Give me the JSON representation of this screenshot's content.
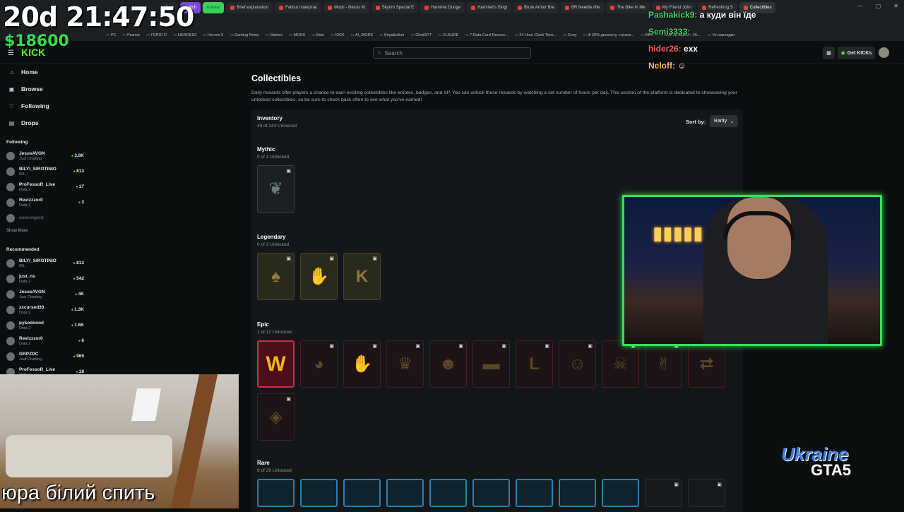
{
  "overlay": {
    "timer": "20d 21:47:50",
    "money": "$18600",
    "room_caption": "юра білий  спить",
    "logo_line1": "Ukraine",
    "logo_line2": "GTA5"
  },
  "browser": {
    "tabs": [
      {
        "label": "Bots",
        "kind": "chip"
      },
      {
        "label": "Twitch",
        "kind": "chip-tw"
      },
      {
        "label": "Kлючи",
        "kind": "chip-k"
      },
      {
        "label": "Brief explanation",
        "kind": "tab"
      },
      {
        "label": "Fallout повертає",
        "kind": "tab"
      },
      {
        "label": "Mods - Nexus M",
        "kind": "tab"
      },
      {
        "label": "Skyrim Special E",
        "kind": "tab"
      },
      {
        "label": "Hammet Dunge",
        "kind": "tab"
      },
      {
        "label": "Hammet's Singl",
        "kind": "tab"
      },
      {
        "label": "Brute Armor Bre",
        "kind": "tab"
      },
      {
        "label": "BR Needle rifle",
        "kind": "tab"
      },
      {
        "label": "The Bike In Me",
        "kind": "tab"
      },
      {
        "label": "My Friend John",
        "kind": "tab"
      },
      {
        "label": "Refreshing S",
        "kind": "tab"
      },
      {
        "label": "Collectibles",
        "kind": "active"
      }
    ],
    "bookmarks": [
      "PC",
      "Разное",
      "ГЕРОЇ 2!",
      "HEROES3",
      "Heroes 5",
      "Gaming News",
      "Games",
      "MODS",
      "Bots",
      "KICK",
      "AI_WORK",
      "Keys&other",
      "ChatGPT",
      "CLAUDE",
      "7-Data Card Recove...",
      "24 Hour Clock Time...",
      "Sony",
      "Ф 20% дисконту, страни...",
      "films",
      "Мой профиль • OL...",
      "Усі закладки"
    ]
  },
  "header": {
    "search_placeholder": "Search",
    "get_kicks_label": "Get KICKs"
  },
  "sidebar": {
    "nav": [
      {
        "label": "Home",
        "icon": "home-icon",
        "glyph": "⌂"
      },
      {
        "label": "Browse",
        "icon": "browse-icon",
        "glyph": "▣"
      },
      {
        "label": "Following",
        "icon": "heart-icon",
        "glyph": "♡"
      },
      {
        "label": "Drops",
        "icon": "drops-icon",
        "glyph": "▤"
      }
    ],
    "following_title": "Following",
    "following": [
      {
        "name": "JesusAVGN",
        "cat": "Just Chatting",
        "viewers": "3.8K"
      },
      {
        "name": "BILYI_SIROTINIO",
        "cat": "IRL",
        "viewers": "813"
      },
      {
        "name": "ProFessoR_Live",
        "cat": "Dota 2",
        "viewers": "17"
      },
      {
        "name": "Revizzzor0",
        "cat": "Dota 2",
        "viewers": "3"
      },
      {
        "name": "asmongold",
        "cat": "",
        "viewers": ""
      }
    ],
    "show_more": "Show More",
    "recommended_title": "Recommended",
    "recommended": [
      {
        "name": "BILYI_SIROTINIO",
        "cat": "IRL",
        "viewers": "813"
      },
      {
        "name": "just_ns",
        "cat": "Dota 2",
        "viewers": "542"
      },
      {
        "name": "JesusAVGN",
        "cat": "Just Chatting",
        "viewers": "4K"
      },
      {
        "name": "zxcursed33",
        "cat": "Dota 2",
        "viewers": "1.3K"
      },
      {
        "name": "pykodoood",
        "cat": "Dota 2",
        "viewers": "1.6K"
      },
      {
        "name": "Revizzzor0",
        "cat": "Dota 2",
        "viewers": "6"
      },
      {
        "name": "GRPZDC",
        "cat": "Just Chatting",
        "viewers": "969"
      },
      {
        "name": "ProFessoR_Live",
        "cat": "Dota 2",
        "viewers": "18"
      }
    ]
  },
  "main": {
    "title": "Collectibles",
    "description": "Daily rewards offer players a chance to earn exciting collectibles like emotes, badges, and XP. You can unlock these rewards by watching a set number of hours per day. This section of the platform is dedicated to showcasing your unlocked collectibles, so be sure to check back often to see what you've earned!",
    "inventory_title": "Inventory",
    "inventory_sub": "49 of 244 Unlocked",
    "sort_label": "Sort by:",
    "sort_value": "Rarity",
    "categories": [
      {
        "title": "Mythic",
        "sub": "0 of 1 Unlocked",
        "cls": "mythic",
        "cards": [
          {
            "art": "❦",
            "locked": true
          }
        ]
      },
      {
        "title": "Legendary",
        "sub": "0 of 3 Unlocked",
        "cls": "legend",
        "cards": [
          {
            "art": "♠",
            "locked": true
          },
          {
            "art": "✋",
            "locked": true
          },
          {
            "art": "K",
            "locked": true
          }
        ]
      },
      {
        "title": "Epic",
        "sub": "1 of 12 Unlocked",
        "cls": "epic",
        "cards": [
          {
            "art": "W",
            "locked": false
          },
          {
            "art": "◕",
            "locked": true
          },
          {
            "art": "✋",
            "locked": true
          },
          {
            "art": "♛",
            "locked": true
          },
          {
            "art": "☻",
            "locked": true
          },
          {
            "art": "▬",
            "locked": true
          },
          {
            "art": "L",
            "locked": true
          },
          {
            "art": "☺",
            "locked": true
          },
          {
            "art": "☠",
            "locked": true
          },
          {
            "art": "✌",
            "locked": true
          },
          {
            "art": "⮂",
            "locked": false
          },
          {
            "art": "◈",
            "locked": true
          }
        ]
      },
      {
        "title": "Rare",
        "sub": "9 of 29 Unlocked",
        "cls": "rare",
        "cards": [
          {
            "art": "",
            "locked": false
          },
          {
            "art": "",
            "locked": false
          },
          {
            "art": "",
            "locked": false
          },
          {
            "art": "",
            "locked": false
          },
          {
            "art": "",
            "locked": false
          },
          {
            "art": "",
            "locked": false
          },
          {
            "art": "",
            "locked": false
          },
          {
            "art": "",
            "locked": false
          },
          {
            "art": "",
            "locked": false
          },
          {
            "art": "",
            "locked": true
          },
          {
            "art": "",
            "locked": true
          }
        ]
      }
    ]
  },
  "chat": [
    {
      "user": "Pashakick9:",
      "msg": "а куди він їде",
      "color": "g"
    },
    {
      "user": "Semi3333:",
      "msg": "",
      "color": "g"
    },
    {
      "user": "hider26:",
      "msg": "exx",
      "color": ""
    },
    {
      "user": "Neloff:",
      "msg": "☺",
      "color": "o"
    }
  ],
  "colors": {
    "accent": "#53fc18",
    "epic_border": "#d62a45",
    "rare_border": "#2a7fb0",
    "cam_border": "#38e05a"
  }
}
